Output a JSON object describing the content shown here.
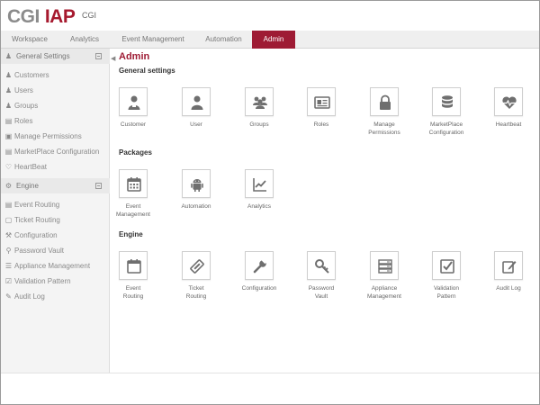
{
  "header": {
    "logo_primary": "CGI",
    "logo_secondary": "IAP",
    "org": "CGI"
  },
  "tabs": [
    {
      "label": "Workspace",
      "active": false
    },
    {
      "label": "Analytics",
      "active": false
    },
    {
      "label": "Event Management",
      "active": false
    },
    {
      "label": "Automation",
      "active": false
    },
    {
      "label": "Admin",
      "active": true
    }
  ],
  "sidebar": {
    "general_group": "General Settings",
    "general_items": [
      "Customers",
      "Users",
      "Groups",
      "Roles",
      "Manage Permissions",
      "MarketPlace Configuration",
      "HeartBeat"
    ],
    "engine_group": "Engine",
    "engine_items": [
      "Event Routing",
      "Ticket Routing",
      "Configuration",
      "Password Vault",
      "Appliance Management",
      "Validation Pattern",
      "Audit Log"
    ]
  },
  "main": {
    "title": "Admin",
    "sections": [
      {
        "title": "General settings",
        "tiles": [
          {
            "label": "Customer",
            "icon": "customer-icon"
          },
          {
            "label": "User",
            "icon": "user-icon"
          },
          {
            "label": "Groups",
            "icon": "groups-icon"
          },
          {
            "label": "Roles",
            "icon": "id-card-icon"
          },
          {
            "label": "Manage\nPermissions",
            "icon": "lock-icon"
          },
          {
            "label": "MarketPlace\nConfiguration",
            "icon": "database-icon"
          },
          {
            "label": "Heartbeat",
            "icon": "heartbeat-icon"
          }
        ]
      },
      {
        "title": "Packages",
        "tiles": [
          {
            "label": "Event\nManagement",
            "icon": "calendar-icon"
          },
          {
            "label": "Automation",
            "icon": "android-icon"
          },
          {
            "label": "Analytics",
            "icon": "line-chart-icon"
          }
        ]
      },
      {
        "title": "Engine",
        "tiles": [
          {
            "label": "Event\nRouting",
            "icon": "calendar-icon"
          },
          {
            "label": "Ticket\nRouting",
            "icon": "ticket-icon"
          },
          {
            "label": "Configuration",
            "icon": "wrench-icon"
          },
          {
            "label": "Password\nVault",
            "icon": "key-icon"
          },
          {
            "label": "Appliance\nManagement",
            "icon": "server-icon"
          },
          {
            "label": "Validation\nPattern",
            "icon": "check-square-icon"
          },
          {
            "label": "Audit Log",
            "icon": "edit-icon"
          }
        ]
      }
    ]
  },
  "colors": {
    "accent": "#9e1b34",
    "logo_grey": "#8b8b8b",
    "icon_grey": "#6f6f6f"
  }
}
